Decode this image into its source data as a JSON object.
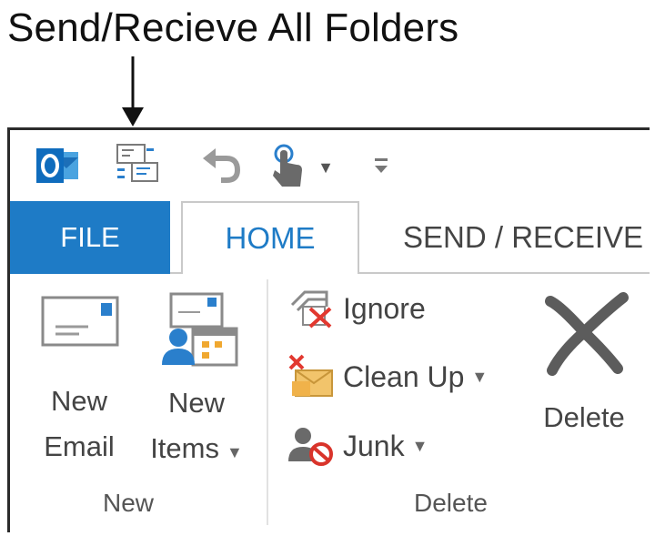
{
  "callout": {
    "label": "Send/Recieve All Folders"
  },
  "quick_access": {
    "app_icon": "outlook-icon",
    "items": [
      "send-receive-all-folders-icon",
      "undo-icon",
      "touch-mode-icon",
      "customize-toolbar-icon"
    ]
  },
  "tabs": {
    "file": "FILE",
    "home": "HOME",
    "send_receive": "SEND / RECEIVE"
  },
  "ribbon": {
    "new_group": {
      "new_email": {
        "line1": "New",
        "line2": "Email"
      },
      "new_items": {
        "line1": "New",
        "line2": "Items"
      },
      "label": "New"
    },
    "delete_group": {
      "ignore": "Ignore",
      "clean_up": "Clean Up",
      "junk": "Junk",
      "delete": "Delete",
      "label": "Delete"
    }
  },
  "colors": {
    "accent": "#1e7bc6",
    "delete_red": "#e2382f",
    "junk_red": "#d9342b"
  }
}
